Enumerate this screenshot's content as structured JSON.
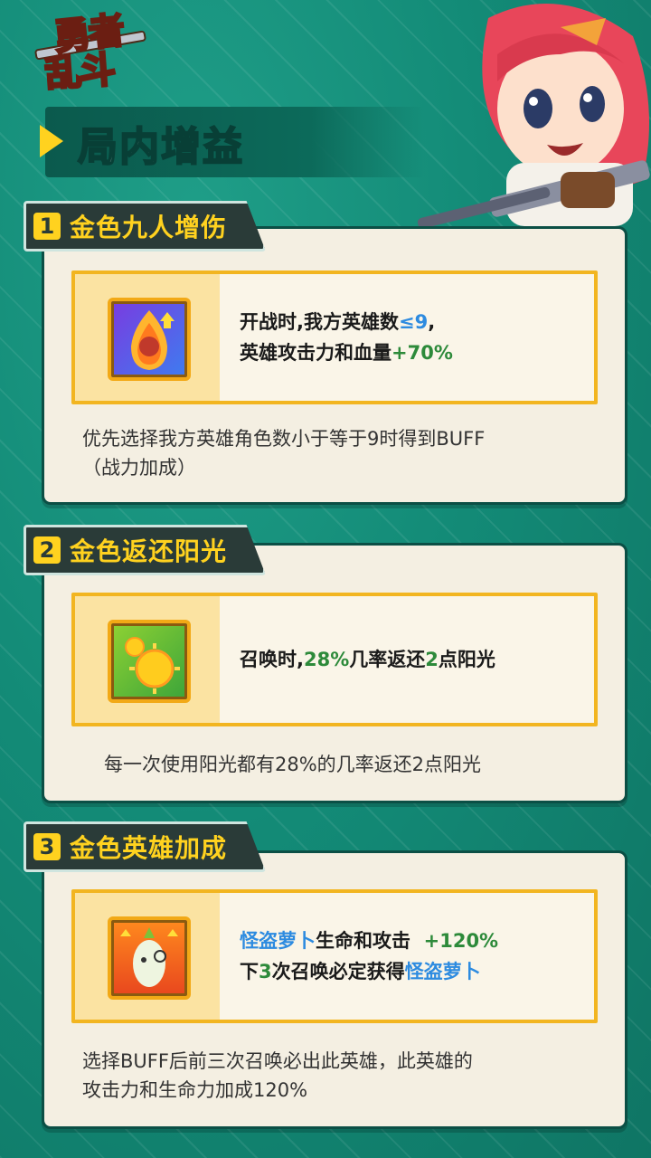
{
  "logo": {
    "line1": "勇者",
    "line2": "乱斗"
  },
  "page_title": "局内增益",
  "sections": [
    {
      "num": "1",
      "title": "金色九人增伤",
      "effect_line1_a": "开战时,我方英雄数",
      "effect_line1_b": "≤9",
      "effect_line1_c": ",",
      "effect_line2_a": "英雄攻击力和血量",
      "effect_line2_b": "+70%",
      "description_line1": "优先选择我方英雄角色数小于等于9时得到BUFF",
      "description_line2": "（战力加成）",
      "icon": "fire-spirit-icon"
    },
    {
      "num": "2",
      "title": "金色返还阳光",
      "effect_a": "召唤时,",
      "effect_b": "28%",
      "effect_c": "几率返还",
      "effect_d": "2",
      "effect_e": "点阳光",
      "description_line1": "每一次使用阳光都有28%的几率返还2点阳光",
      "icon": "sun-icon"
    },
    {
      "num": "3",
      "title": "金色英雄加成",
      "effect_line1_a": "怪盗萝卜",
      "effect_line1_b": "生命和攻击",
      "effect_line1_c": "+120%",
      "effect_line2_a": "下",
      "effect_line2_b": "3",
      "effect_line2_c": "次召唤必定获得",
      "effect_line2_d": "怪盗萝卜",
      "description_line1": "选择BUFF后前三次召唤必出此英雄，此英雄的",
      "description_line2": "攻击力和生命力加成120%",
      "icon": "radish-thief-icon"
    }
  ]
}
